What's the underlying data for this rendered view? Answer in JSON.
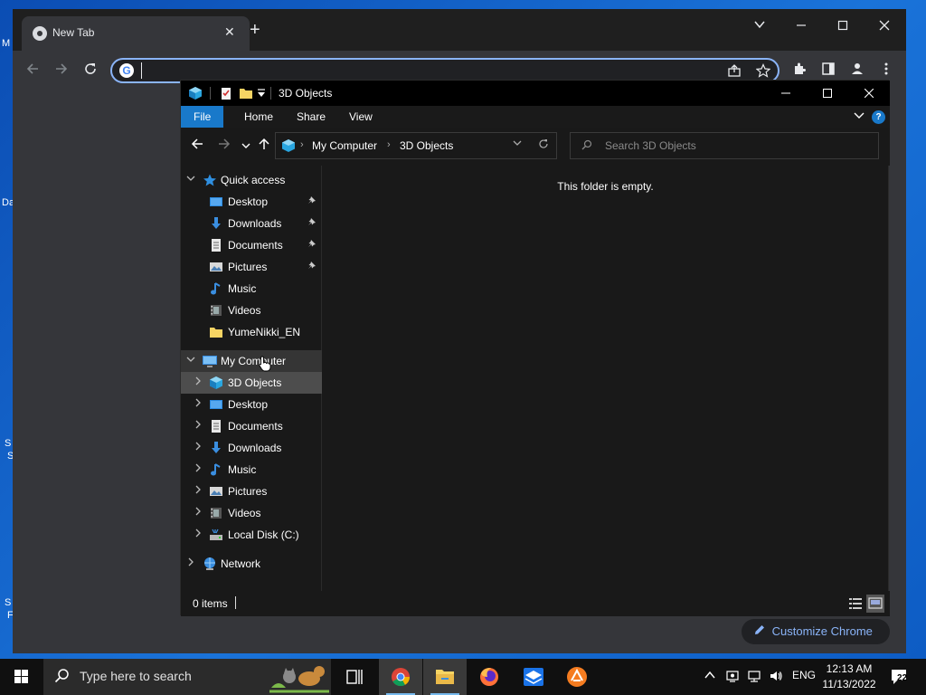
{
  "chrome": {
    "tab_title": "New Tab",
    "tab_close": "✕",
    "new_tab": "+",
    "omnibox_value": "",
    "customize_label": "Customize Chrome"
  },
  "explorer": {
    "title": "3D Objects",
    "ribbon_tabs": [
      "File",
      "Home",
      "Share",
      "View"
    ],
    "help": "?",
    "address": [
      "My Computer",
      "3D Objects"
    ],
    "search_placeholder": "Search 3D Objects",
    "quick_access_label": "Quick access",
    "quick_access": [
      {
        "label": "Desktop",
        "pinned": true
      },
      {
        "label": "Downloads",
        "pinned": true
      },
      {
        "label": "Documents",
        "pinned": true
      },
      {
        "label": "Pictures",
        "pinned": true
      },
      {
        "label": "Music",
        "pinned": false
      },
      {
        "label": "Videos",
        "pinned": false
      },
      {
        "label": "YumeNikki_EN",
        "pinned": false
      }
    ],
    "computer_label": "My Computer",
    "computer_items": [
      "3D Objects",
      "Desktop",
      "Documents",
      "Downloads",
      "Music",
      "Pictures",
      "Videos",
      "Local Disk (C:)"
    ],
    "network_label": "Network",
    "empty_message": "This folder is empty.",
    "status": "0 items"
  },
  "taskbar": {
    "search_placeholder": "Type here to search",
    "language": "ENG",
    "time": "12:13 AM",
    "date": "11/13/2022",
    "notification_count": "22"
  },
  "colors": {
    "accent": "#1979ca",
    "link": "#8ab4f8",
    "desktop": "#1565c0"
  }
}
